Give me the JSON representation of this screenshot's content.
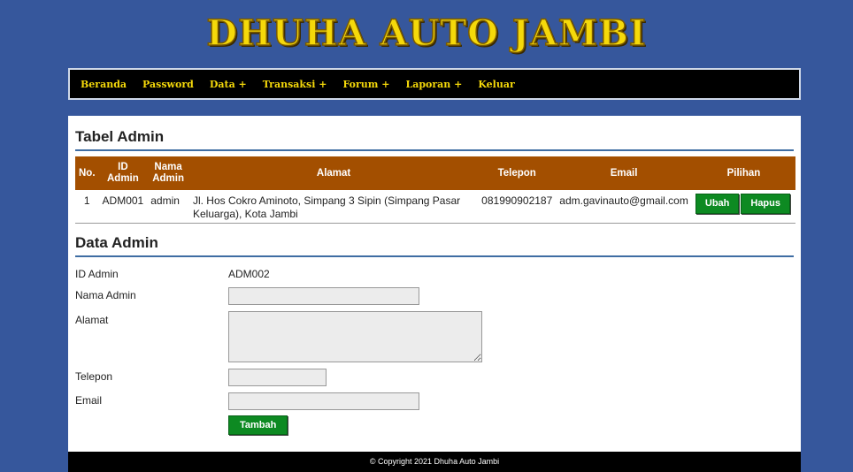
{
  "header": {
    "logo_text": "DHUHA AUTO JAMBI"
  },
  "nav": {
    "items": [
      "Beranda",
      "Password",
      "Data +",
      "Transaksi +",
      "Forum +",
      "Laporan +",
      "Keluar"
    ]
  },
  "table_section": {
    "title": "Tabel Admin",
    "columns": [
      "No.",
      "ID Admin",
      "Nama Admin",
      "Alamat",
      "Telepon",
      "Email",
      "Pilihan"
    ],
    "rows": [
      {
        "no": "1",
        "id": "ADM001",
        "nama": "admin",
        "alamat": "Jl. Hos Cokro Aminoto, Simpang 3 Sipin (Simpang Pasar Keluarga), Kota Jambi",
        "telepon": "081990902187",
        "email": "adm.gavinauto@gmail.com",
        "edit_label": "Ubah",
        "delete_label": "Hapus"
      }
    ]
  },
  "form": {
    "title": "Data Admin",
    "id_label": "ID Admin",
    "id_value": "ADM002",
    "nama_label": "Nama Admin",
    "nama_value": "",
    "alamat_label": "Alamat",
    "alamat_value": "",
    "telepon_label": "Telepon",
    "telepon_value": "",
    "email_label": "Email",
    "email_value": "",
    "submit_label": "Tambah"
  },
  "footer": {
    "text": "© Copyright 2021 Dhuha Auto Jambi"
  },
  "colors": {
    "background": "#36579c",
    "table_header": "#a34f00",
    "button": "#0d8a22",
    "logo": "#f5d90a"
  }
}
